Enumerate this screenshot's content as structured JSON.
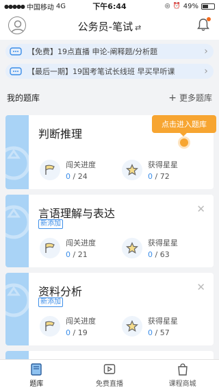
{
  "status_bar": {
    "carrier": "中国移动",
    "network": "4G",
    "time": "下午6:44",
    "battery": "49%",
    "battery_level": 0.49
  },
  "header": {
    "title": "公务员-笔试",
    "swap_glyph": "⇄"
  },
  "notices": [
    {
      "text": "【免费】19点直播 申论-阐释题/分析题"
    },
    {
      "text": "【最后一期】19国考笔试长线班 早买早听课"
    }
  ],
  "section": {
    "title": "我的题库",
    "more_label": "更多题库"
  },
  "tooltip": {
    "label": "点击进入题库"
  },
  "cards": [
    {
      "title": "判断推理",
      "badge": "",
      "progress_label": "闯关进度",
      "progress_current": "0",
      "progress_total": "/ 24",
      "stars_label": "获得星星",
      "stars_current": "0",
      "stars_total": "/ 72"
    },
    {
      "title": "言语理解与表达",
      "badge": "新添加",
      "progress_label": "闯关进度",
      "progress_current": "0",
      "progress_total": "/ 21",
      "stars_label": "获得星星",
      "stars_current": "0",
      "stars_total": "/ 63"
    },
    {
      "title": "资料分析",
      "badge": "新添加",
      "progress_label": "闯关进度",
      "progress_current": "0",
      "progress_total": "/ 19",
      "stars_label": "获得星星",
      "stars_current": "0",
      "stars_total": "/ 57"
    }
  ],
  "tabs": [
    {
      "label": "题库",
      "icon": "book-icon",
      "active": true
    },
    {
      "label": "免费直播",
      "icon": "play-icon",
      "active": false
    },
    {
      "label": "课程商城",
      "icon": "shopping-bag-icon",
      "active": false
    }
  ],
  "colors": {
    "accent": "#3b8de8",
    "tooltip": "#f7a531",
    "notice_bg": "#e6effb",
    "card_strip": "#a9d3f6"
  }
}
